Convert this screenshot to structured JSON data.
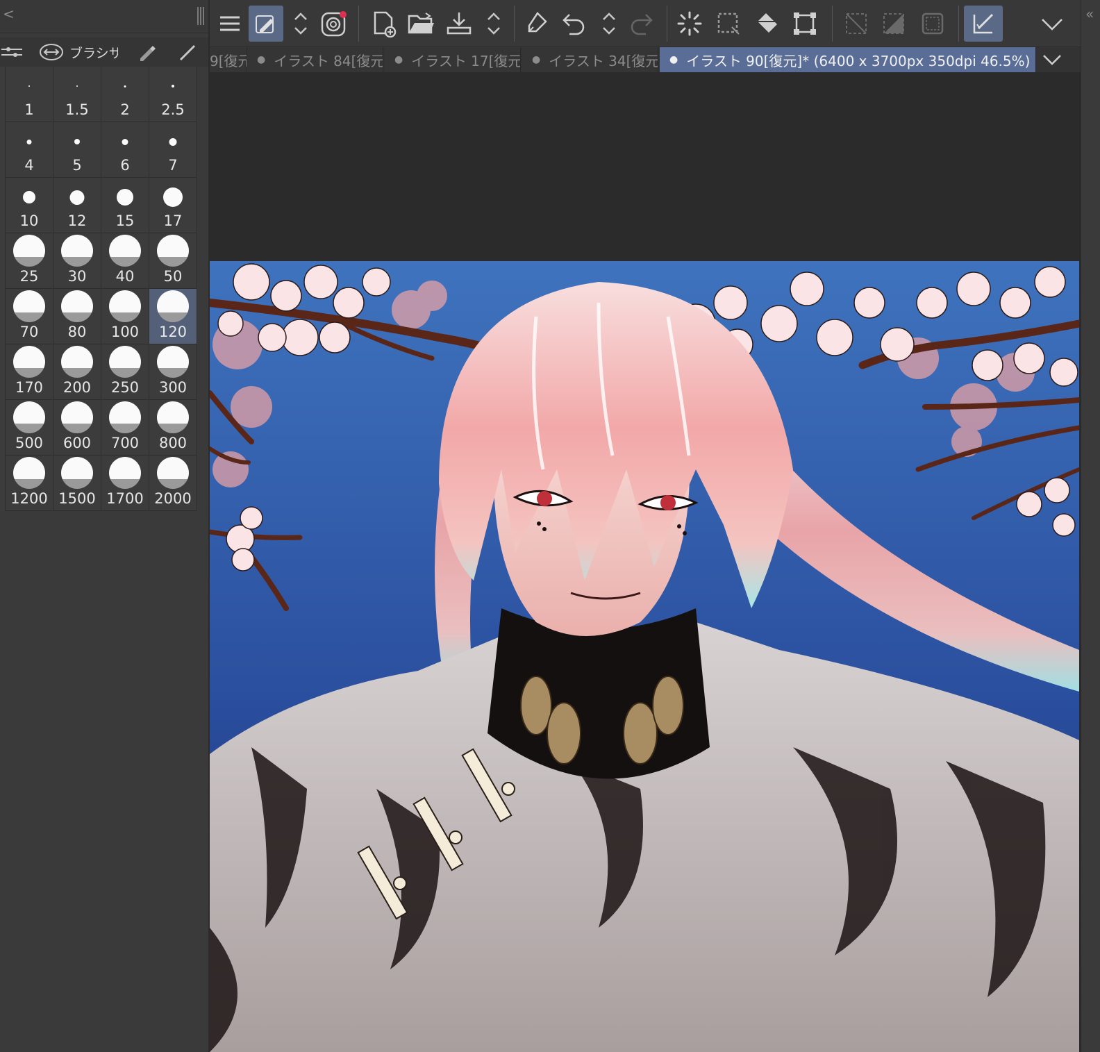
{
  "left_panel": {
    "brush_tab_label": "ブラシサ",
    "brush_sizes": [
      "1",
      "1.5",
      "2",
      "2.5",
      "4",
      "5",
      "6",
      "7",
      "10",
      "12",
      "15",
      "17",
      "25",
      "30",
      "40",
      "50",
      "70",
      "80",
      "100",
      "120",
      "170",
      "200",
      "250",
      "300",
      "500",
      "600",
      "700",
      "800",
      "1200",
      "1500",
      "1700",
      "2000"
    ],
    "selected_size": "120"
  },
  "toolbar": {
    "icons": [
      "menu-icon",
      "pen-settings-icon",
      "chevron-updown-icon",
      "spiral-icon",
      "new-canvas-icon",
      "open-folder-icon",
      "save-icon",
      "chevron-updown-icon",
      "eraser-icon",
      "undo-icon",
      "chevron-updown-icon",
      "redo-icon",
      "loading-spinner-icon",
      "selection-icon",
      "fill-icon",
      "transform-icon",
      "clear-selection-icon",
      "invert-selection-icon",
      "selection-border-icon",
      "check-pen-icon",
      "dropdown-icon"
    ]
  },
  "tabs": [
    {
      "label": "9[復元"
    },
    {
      "label": "イラスト 84[復元"
    },
    {
      "label": "イラスト 17[復元"
    },
    {
      "label": "イラスト 34[復元"
    },
    {
      "label": "イラスト 90[復元]* (6400 x 3700px 350dpi 46.5%)"
    }
  ],
  "colors": {
    "accent": "#5a6d96",
    "panel_bg": "#3a3a3a",
    "canvas_bg": "#2b2b2b",
    "sky_top": "#3d6fb5",
    "sky_bottom": "#1a2c7a",
    "hair": "#f4b8b8",
    "blossom": "#fbe3e6"
  }
}
